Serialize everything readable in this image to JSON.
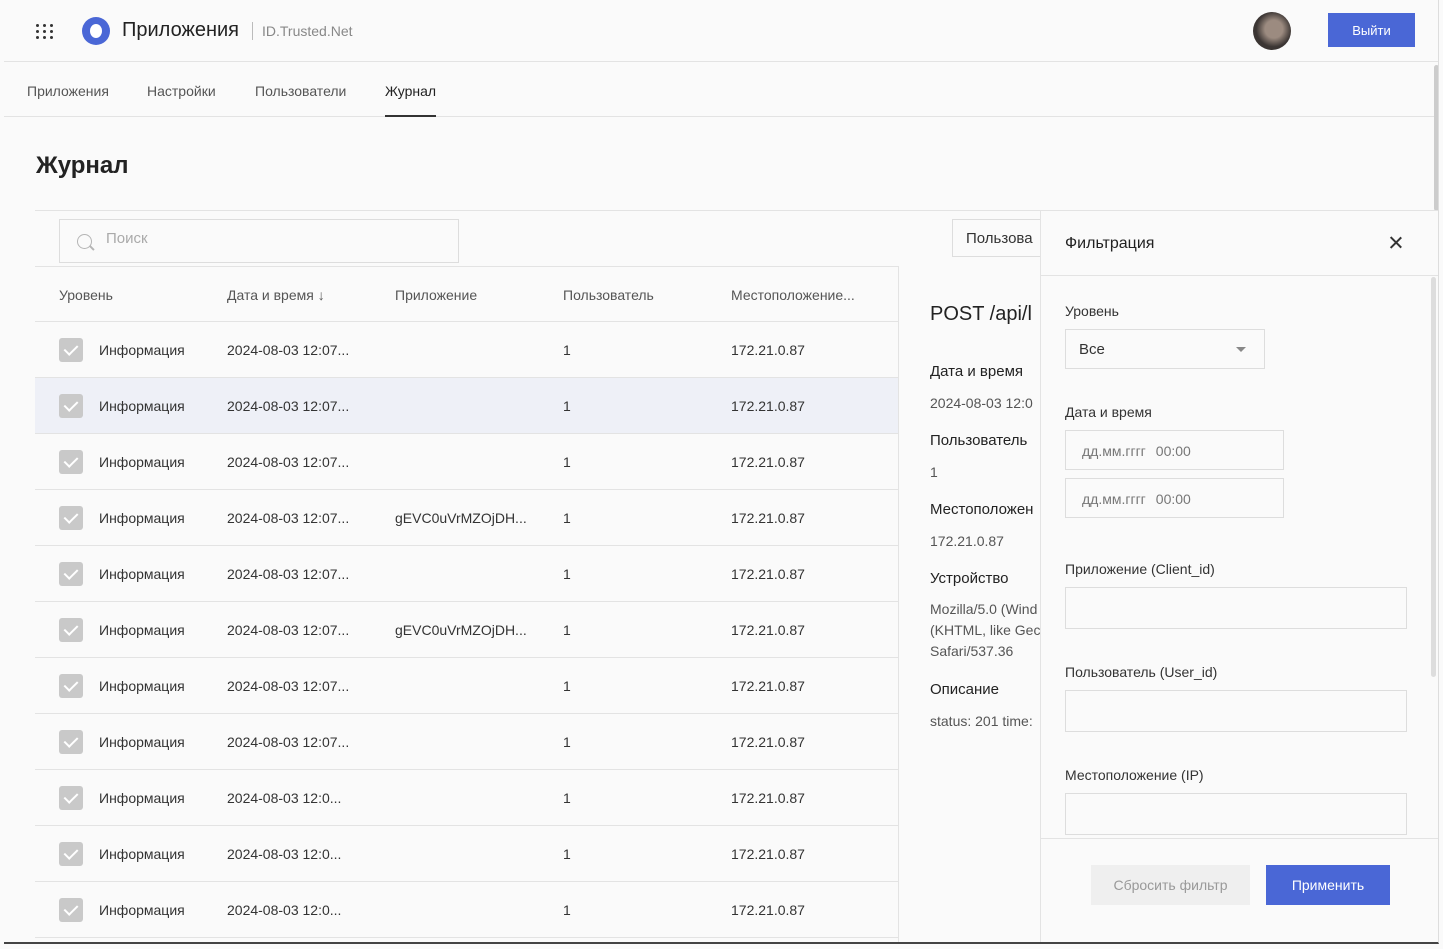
{
  "header": {
    "app_title": "Приложения",
    "app_subtitle": "ID.Trusted.Net",
    "logout_label": "Выйти"
  },
  "tabs": [
    {
      "label": "Приложения"
    },
    {
      "label": "Настройки"
    },
    {
      "label": "Пользователи"
    },
    {
      "label": "Журнал"
    }
  ],
  "page_title": "Журнал",
  "search": {
    "placeholder": "Поиск"
  },
  "user_select_label": "Пользова",
  "table": {
    "columns": [
      "Уровень",
      "Дата и время ↓",
      "Приложение",
      "Пользователь",
      "Местоположение..."
    ],
    "rows": [
      {
        "level": "Информация",
        "date": "2024-08-03 12:07...",
        "app": "",
        "user": "1",
        "ip": "172.21.0.87"
      },
      {
        "level": "Информация",
        "date": "2024-08-03 12:07...",
        "app": "",
        "user": "1",
        "ip": "172.21.0.87"
      },
      {
        "level": "Информация",
        "date": "2024-08-03 12:07...",
        "app": "",
        "user": "1",
        "ip": "172.21.0.87"
      },
      {
        "level": "Информация",
        "date": "2024-08-03 12:07...",
        "app": "gEVC0uVrMZOjDH...",
        "user": "1",
        "ip": "172.21.0.87"
      },
      {
        "level": "Информация",
        "date": "2024-08-03 12:07...",
        "app": "",
        "user": "1",
        "ip": "172.21.0.87"
      },
      {
        "level": "Информация",
        "date": "2024-08-03 12:07...",
        "app": "gEVC0uVrMZOjDH...",
        "user": "1",
        "ip": "172.21.0.87"
      },
      {
        "level": "Информация",
        "date": "2024-08-03 12:07...",
        "app": "",
        "user": "1",
        "ip": "172.21.0.87"
      },
      {
        "level": "Информация",
        "date": "2024-08-03 12:07...",
        "app": "",
        "user": "1",
        "ip": "172.21.0.87"
      },
      {
        "level": "Информация",
        "date": "2024-08-03 12:0...",
        "app": "",
        "user": "1",
        "ip": "172.21.0.87"
      },
      {
        "level": "Информация",
        "date": "2024-08-03 12:0...",
        "app": "",
        "user": "1",
        "ip": "172.21.0.87"
      },
      {
        "level": "Информация",
        "date": "2024-08-03 12:0...",
        "app": "",
        "user": "1",
        "ip": "172.21.0.87"
      }
    ]
  },
  "detail": {
    "title": "POST /api/l",
    "date_label": "Дата и время",
    "date_value": "2024-08-03 12:0",
    "user_label": "Пользователь",
    "user_value": "1",
    "location_label": "Местоположен",
    "location_value": "172.21.0.87",
    "device_label": "Устройство",
    "device_lines": [
      "Mozilla/5.0 (Wind",
      "(KHTML, like Gec",
      "Safari/537.36"
    ],
    "description_label": "Описание",
    "description_value": "status: 201 time:"
  },
  "filter": {
    "title": "Фильтрация",
    "level_label": "Уровень",
    "level_value": "Все",
    "datetime_label": "Дата и время",
    "date_placeholder": "дд.мм.гггг",
    "time_placeholder": "00:00",
    "app_label": "Приложение (Client_id)",
    "user_label": "Пользователь (User_id)",
    "ip_label": "Местоположение (IP)",
    "reset_label": "Сбросить фильтр",
    "apply_label": "Применить"
  },
  "colors": {
    "accent": "#4a67d6",
    "selected_row": "#eef0f7"
  }
}
